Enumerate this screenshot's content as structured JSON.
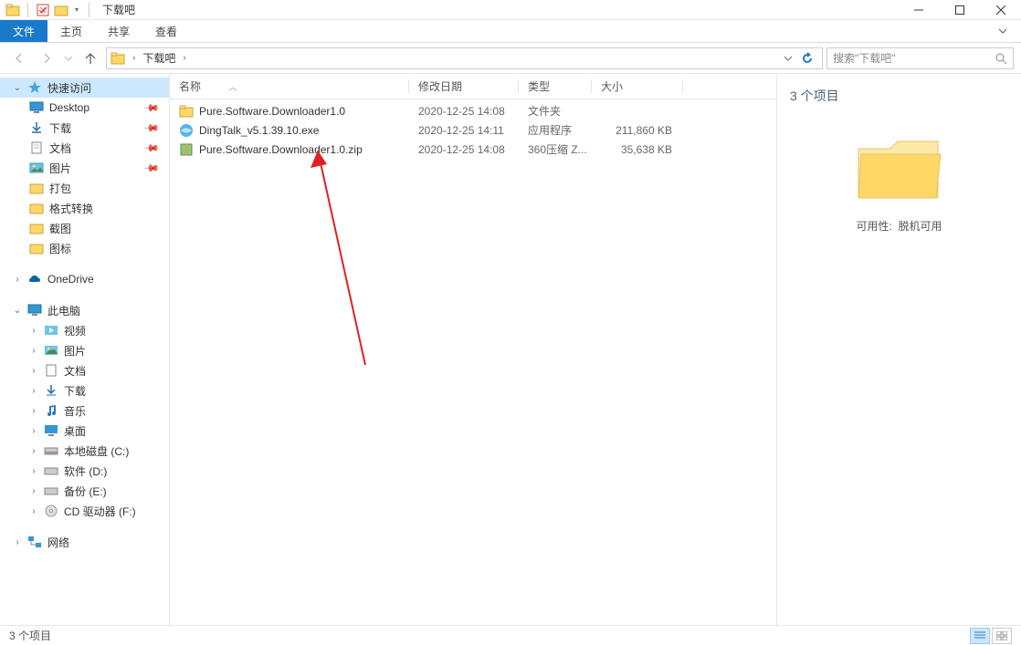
{
  "window": {
    "title": "下载吧"
  },
  "ribbon": {
    "file": "文件",
    "tabs": [
      "主页",
      "共享",
      "查看"
    ]
  },
  "breadcrumb": {
    "segments": [
      "下载吧"
    ]
  },
  "search": {
    "placeholder": "搜索\"下载吧\""
  },
  "sidebar": {
    "quick_access": "快速访问",
    "pinned": [
      {
        "label": "Desktop"
      },
      {
        "label": "下载"
      },
      {
        "label": "文档"
      },
      {
        "label": "图片"
      }
    ],
    "recent": [
      {
        "label": "打包"
      },
      {
        "label": "格式转换"
      },
      {
        "label": "截图"
      },
      {
        "label": "图标"
      }
    ],
    "onedrive": "OneDrive",
    "this_pc": "此电脑",
    "pc_items": [
      {
        "label": "视频"
      },
      {
        "label": "图片"
      },
      {
        "label": "文档"
      },
      {
        "label": "下载"
      },
      {
        "label": "音乐"
      },
      {
        "label": "桌面"
      },
      {
        "label": "本地磁盘 (C:)"
      },
      {
        "label": "软件 (D:)"
      },
      {
        "label": "备份 (E:)"
      },
      {
        "label": "CD 驱动器 (F:)"
      }
    ],
    "network": "网络"
  },
  "columns": {
    "name": "名称",
    "date": "修改日期",
    "type": "类型",
    "size": "大小"
  },
  "files": [
    {
      "name": "Pure.Software.Downloader1.0",
      "date": "2020-12-25 14:08",
      "type": "文件夹",
      "size": "",
      "icon": "folder"
    },
    {
      "name": "DingTalk_v5.1.39.10.exe",
      "date": "2020-12-25 14:11",
      "type": "应用程序",
      "size": "211,860 KB",
      "icon": "exe"
    },
    {
      "name": "Pure.Software.Downloader1.0.zip",
      "date": "2020-12-25 14:08",
      "type": "360压缩 Z...",
      "size": "35,638 KB",
      "icon": "zip"
    }
  ],
  "details": {
    "count_label": "3 个项目",
    "avail_label": "可用性:",
    "avail_value": "脱机可用"
  },
  "status": {
    "left": "3 个项目"
  }
}
